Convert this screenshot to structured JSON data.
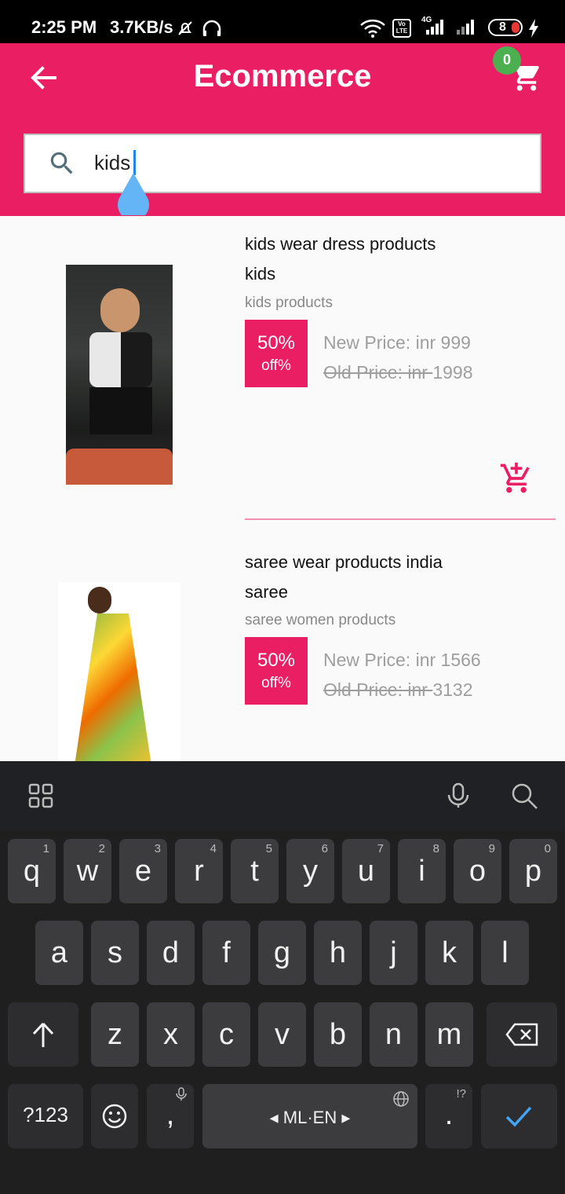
{
  "status_bar": {
    "time": "2:25 PM",
    "net_speed": "3.7KB/s",
    "network_label": "4G",
    "volte_label": "Vo LTE",
    "battery": "8"
  },
  "app_bar": {
    "title": "Ecommerce",
    "cart_count": "0",
    "search_value": "kids",
    "accent_color": "#e91e63"
  },
  "products": [
    {
      "title": "kids wear dress products",
      "category": "kids",
      "subtitle": "kids products",
      "discount": "50%",
      "discount_suffix": "off%",
      "new_price": "New Price: inr 999",
      "old_price_label": "Old Price: inr ",
      "old_price_value": "1998"
    },
    {
      "title": "saree wear products india",
      "category": "saree",
      "subtitle": "saree women products",
      "discount": "50%",
      "discount_suffix": "off%",
      "new_price": "New Price: inr 1566",
      "old_price_label": "Old Price: inr ",
      "old_price_value": "3132"
    }
  ],
  "keyboard": {
    "row1": [
      "q",
      "w",
      "e",
      "r",
      "t",
      "y",
      "u",
      "i",
      "o",
      "p"
    ],
    "row1_hints": [
      "1",
      "2",
      "3",
      "4",
      "5",
      "6",
      "7",
      "8",
      "9",
      "0"
    ],
    "row2": [
      "a",
      "s",
      "d",
      "f",
      "g",
      "h",
      "j",
      "k",
      "l"
    ],
    "row3": [
      "z",
      "x",
      "c",
      "v",
      "b",
      "n",
      "m"
    ],
    "symbols_key": "?123",
    "comma_key": ",",
    "space_label": "ML·EN",
    "period_key": ".",
    "period_hint": "!?"
  }
}
